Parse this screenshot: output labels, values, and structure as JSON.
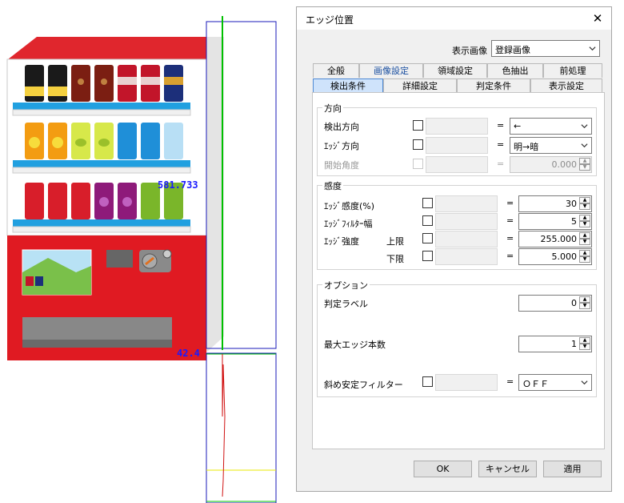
{
  "scene": {
    "measure_top": "581.733",
    "measure_bottom": "42.4",
    "colors": {
      "machine_red": "#e01a22",
      "roof_red": "#e0262d",
      "shelf_blue": "#21a0e0",
      "marker_blue": "#1a1aff",
      "line_green": "#00c000"
    }
  },
  "dialog": {
    "title": "エッジ位置",
    "close_symbol": "✕",
    "display_image_label": "表示画像",
    "display_image_value": "登録画像",
    "tabs_row1": [
      {
        "label": "全般"
      },
      {
        "label": "画像設定"
      },
      {
        "label": "領域設定"
      },
      {
        "label": "色抽出"
      },
      {
        "label": "前処理"
      }
    ],
    "tabs_row2": [
      {
        "label": "検出条件"
      },
      {
        "label": "詳細設定"
      },
      {
        "label": "判定条件"
      },
      {
        "label": "表示設定"
      }
    ],
    "direction_group": {
      "title": "方向",
      "detect_direction_label": "検出方向",
      "detect_direction_value": "←",
      "edge_direction_label": "ｴｯｼﾞ方向",
      "edge_direction_value": "明→暗",
      "start_angle_label": "開始角度",
      "start_angle_value": "0.000"
    },
    "sensitivity_group": {
      "title": "感度",
      "edge_sensitivity_label": "ｴｯｼﾞ感度(%)",
      "edge_sensitivity_value": "30",
      "edge_filter_label": "ｴｯｼﾞﾌｨﾙﾀｰ幅",
      "edge_filter_value": "5",
      "edge_strength_label": "ｴｯｼﾞ強度",
      "upper_label": "上限",
      "upper_value": "255.000",
      "lower_label": "下限",
      "lower_value": "5.000"
    },
    "options_group": {
      "title": "オプション",
      "judge_label_label": "判定ラベル",
      "judge_label_value": "0",
      "max_edge_label": "最大エッジ本数",
      "max_edge_value": "1",
      "oblique_filter_label": "斜め安定フィルター",
      "oblique_filter_value": "ＯＦＦ"
    },
    "equals": "=",
    "ok_label": "OK",
    "cancel_label": "キャンセル",
    "apply_label": "適用"
  }
}
